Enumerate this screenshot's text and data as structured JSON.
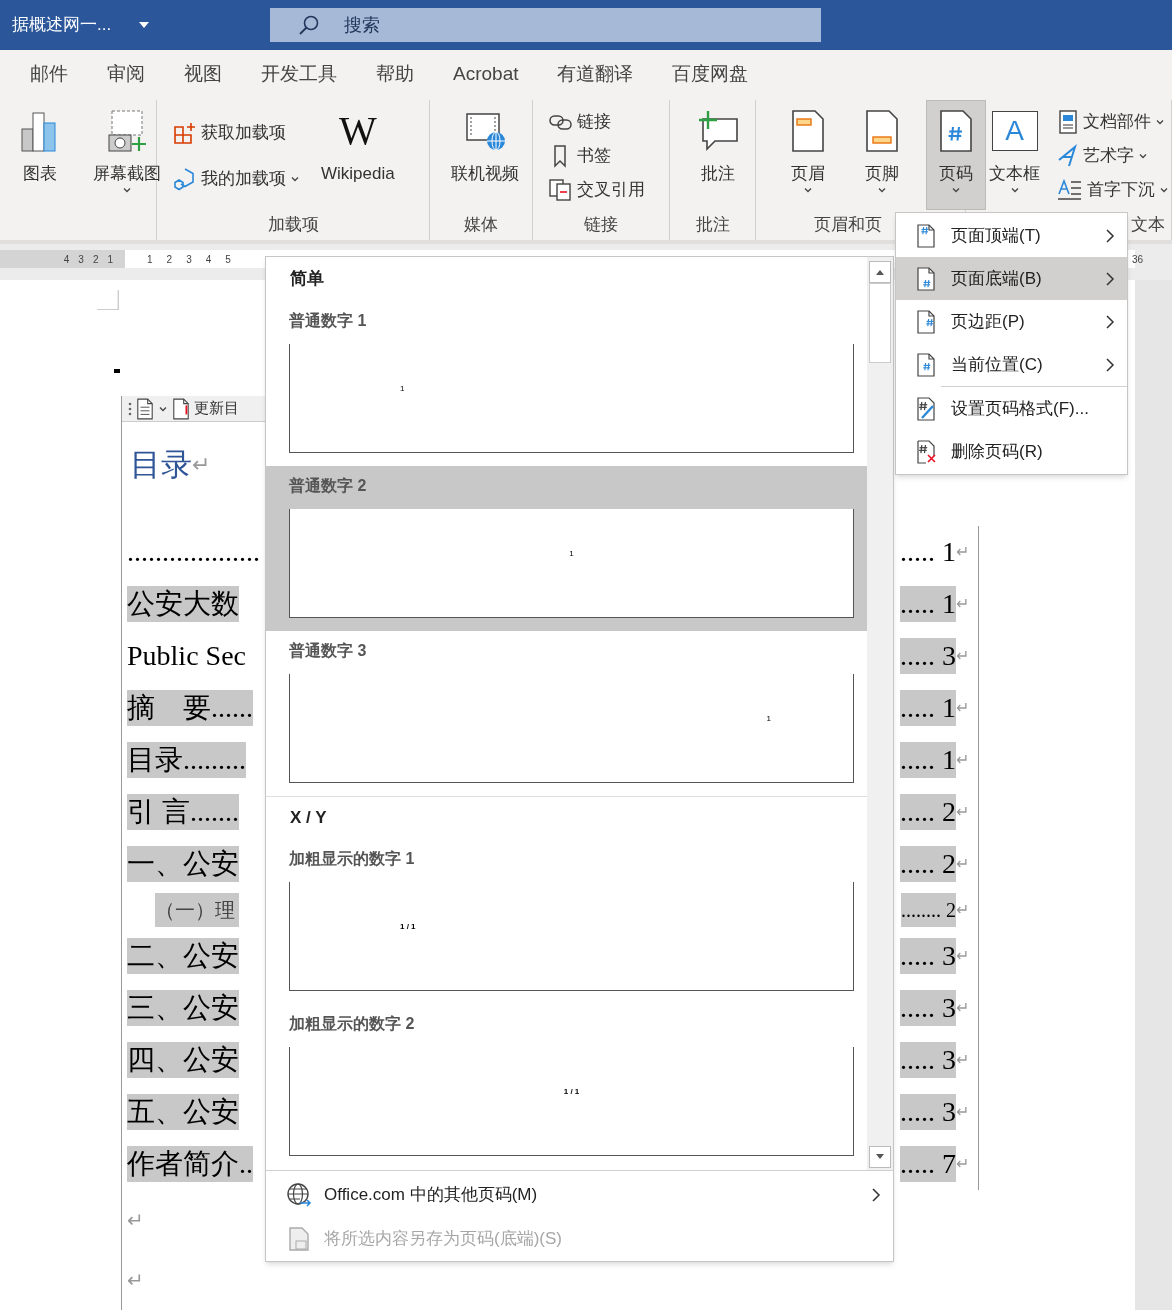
{
  "title_bar": {
    "document_title": "据概述网一...",
    "search": {
      "placeholder": "搜索"
    }
  },
  "ribbon_tabs": [
    "邮件",
    "审阅",
    "视图",
    "开发工具",
    "帮助",
    "Acrobat",
    "有道翻译",
    "百度网盘"
  ],
  "ribbon_groups": [
    {
      "items": [
        {
          "label": "图表",
          "kind": "large",
          "dropdown": false,
          "pressed": false
        },
        {
          "label": "屏幕截图",
          "kind": "large",
          "dropdown": true,
          "pressed": false
        }
      ]
    },
    {
      "label": "加载项",
      "items": [
        {
          "label": "获取加载项",
          "kind": "small",
          "dropdown": false,
          "pressed": false
        },
        {
          "label": "我的加载项",
          "kind": "small",
          "dropdown": true,
          "pressed": false
        },
        {
          "label": "Wikipedia",
          "kind": "large",
          "dropdown": false,
          "pressed": false,
          "icon_text": "W"
        }
      ]
    },
    {
      "label": "媒体",
      "items": [
        {
          "label": "联机视频",
          "kind": "large",
          "dropdown": false,
          "pressed": false
        }
      ]
    },
    {
      "label": "链接",
      "items": [
        {
          "label": "链接",
          "kind": "small",
          "dropdown": false,
          "pressed": false
        },
        {
          "label": "书签",
          "kind": "small",
          "dropdown": false,
          "pressed": false
        },
        {
          "label": "交叉引用",
          "kind": "small",
          "dropdown": false,
          "pressed": false
        }
      ]
    },
    {
      "label": "批注",
      "items": [
        {
          "label": "批注",
          "kind": "large",
          "dropdown": false,
          "pressed": false
        }
      ]
    },
    {
      "label": "页眉和页",
      "items": [
        {
          "label": "页眉",
          "kind": "large",
          "dropdown": true,
          "pressed": false
        },
        {
          "label": "页脚",
          "kind": "large",
          "dropdown": true,
          "pressed": false
        },
        {
          "label": "页码",
          "kind": "large",
          "dropdown": true,
          "pressed": true
        }
      ]
    },
    {
      "label": "文本",
      "items": [
        {
          "label": "文本框",
          "kind": "large",
          "dropdown": true,
          "pressed": false,
          "icon_text": "A"
        },
        {
          "label": "文档部件",
          "kind": "small",
          "dropdown": true,
          "pressed": false
        },
        {
          "label": "艺术字",
          "kind": "small",
          "dropdown": true,
          "pressed": false
        },
        {
          "label": "首字下沉",
          "kind": "small",
          "dropdown": true,
          "pressed": false
        }
      ]
    }
  ],
  "ruler": {
    "left_marks": [
      "4",
      "3",
      "2",
      "1"
    ],
    "right_marks": [
      "1",
      "2",
      "3",
      "4",
      "5"
    ],
    "end_mark": "36"
  },
  "toc": {
    "toolbar_label": "更新目",
    "heading": "目录",
    "heading_mark": "↵",
    "rows": [
      {
        "kind": "entry",
        "left": "...................",
        "left_highlighted": false,
        "right": "..... 1",
        "right_highlighted": false,
        "mark": "↵"
      },
      {
        "kind": "entry",
        "left": "公安大数",
        "left_highlighted": true,
        "right": "..... 1",
        "right_highlighted": true,
        "mark": "↵"
      },
      {
        "kind": "entry",
        "left": "Public Sec",
        "left_highlighted": false,
        "right": "..... 3",
        "right_highlighted": true,
        "mark": "↵"
      },
      {
        "kind": "entry",
        "left": "摘　要......",
        "left_highlighted": true,
        "right": "..... 1",
        "right_highlighted": true,
        "mark": "↵"
      },
      {
        "kind": "entry",
        "left": "目录.........",
        "left_highlighted": true,
        "right": "..... 1",
        "right_highlighted": true,
        "mark": "↵"
      },
      {
        "kind": "entry",
        "left": "引 言.......",
        "left_highlighted": true,
        "right": "..... 2",
        "right_highlighted": true,
        "mark": "↵"
      },
      {
        "kind": "entry",
        "left": "一、公安",
        "left_highlighted": true,
        "right": "..... 2",
        "right_highlighted": true,
        "mark": "↵"
      },
      {
        "kind": "sub",
        "left": "（一）理",
        "left_highlighted": true,
        "right": "........ 2",
        "right_highlighted": true,
        "mark": "↵"
      },
      {
        "kind": "entry",
        "left": "二、公安",
        "left_highlighted": true,
        "right": "..... 3",
        "right_highlighted": true,
        "mark": "↵"
      },
      {
        "kind": "entry",
        "left": "三、公安",
        "left_highlighted": true,
        "right": "..... 3",
        "right_highlighted": true,
        "mark": "↵"
      },
      {
        "kind": "entry",
        "left": "四、公安",
        "left_highlighted": true,
        "right": "..... 3",
        "right_highlighted": true,
        "mark": "↵"
      },
      {
        "kind": "entry",
        "left": "五、公安",
        "left_highlighted": true,
        "right": "..... 3",
        "right_highlighted": true,
        "mark": "↵"
      },
      {
        "kind": "entry",
        "left": "作者简介..",
        "left_highlighted": true,
        "right": "..... 7",
        "right_highlighted": true,
        "mark": "↵"
      }
    ],
    "trailing_marks": [
      "↵",
      "↵"
    ]
  },
  "gallery": {
    "sections": [
      {
        "heading": "简单",
        "items": [
          {
            "label": "普通数字 1",
            "preview": "1",
            "kind": "left",
            "preview_bold": false,
            "selected": false
          },
          {
            "label": "普通数字 2",
            "preview": "1",
            "kind": "center",
            "preview_bold": false,
            "selected": true
          },
          {
            "label": "普通数字 3",
            "preview": "1",
            "kind": "right",
            "preview_bold": false,
            "selected": false
          }
        ]
      },
      {
        "heading": "X / Y",
        "items": [
          {
            "label": "加粗显示的数字 1",
            "preview": "1 / 1",
            "kind": "left",
            "preview_bold": true,
            "selected": false
          },
          {
            "label": "加粗显示的数字 2",
            "preview": "1 / 1",
            "kind": "center",
            "preview_bold": true,
            "selected": false
          }
        ]
      }
    ],
    "footer_items": [
      {
        "label": "Office.com 中的其他页码(M)",
        "disabled": false,
        "submenu": true
      },
      {
        "label": "将所选内容另存为页码(底端)(S)",
        "disabled": true,
        "submenu": false
      }
    ]
  },
  "page_number_menu": [
    {
      "label": "页面顶端(T)",
      "submenu": true,
      "selected": false,
      "separator_before": false
    },
    {
      "label": "页面底端(B)",
      "submenu": true,
      "selected": true,
      "separator_before": false
    },
    {
      "label": "页边距(P)",
      "submenu": true,
      "selected": false,
      "separator_before": false
    },
    {
      "label": "当前位置(C)",
      "submenu": true,
      "selected": false,
      "separator_before": false
    },
    {
      "label": "设置页码格式(F)...",
      "submenu": false,
      "selected": false,
      "separator_before": true
    },
    {
      "label": "删除页码(R)",
      "submenu": false,
      "selected": false,
      "separator_before": false
    }
  ]
}
